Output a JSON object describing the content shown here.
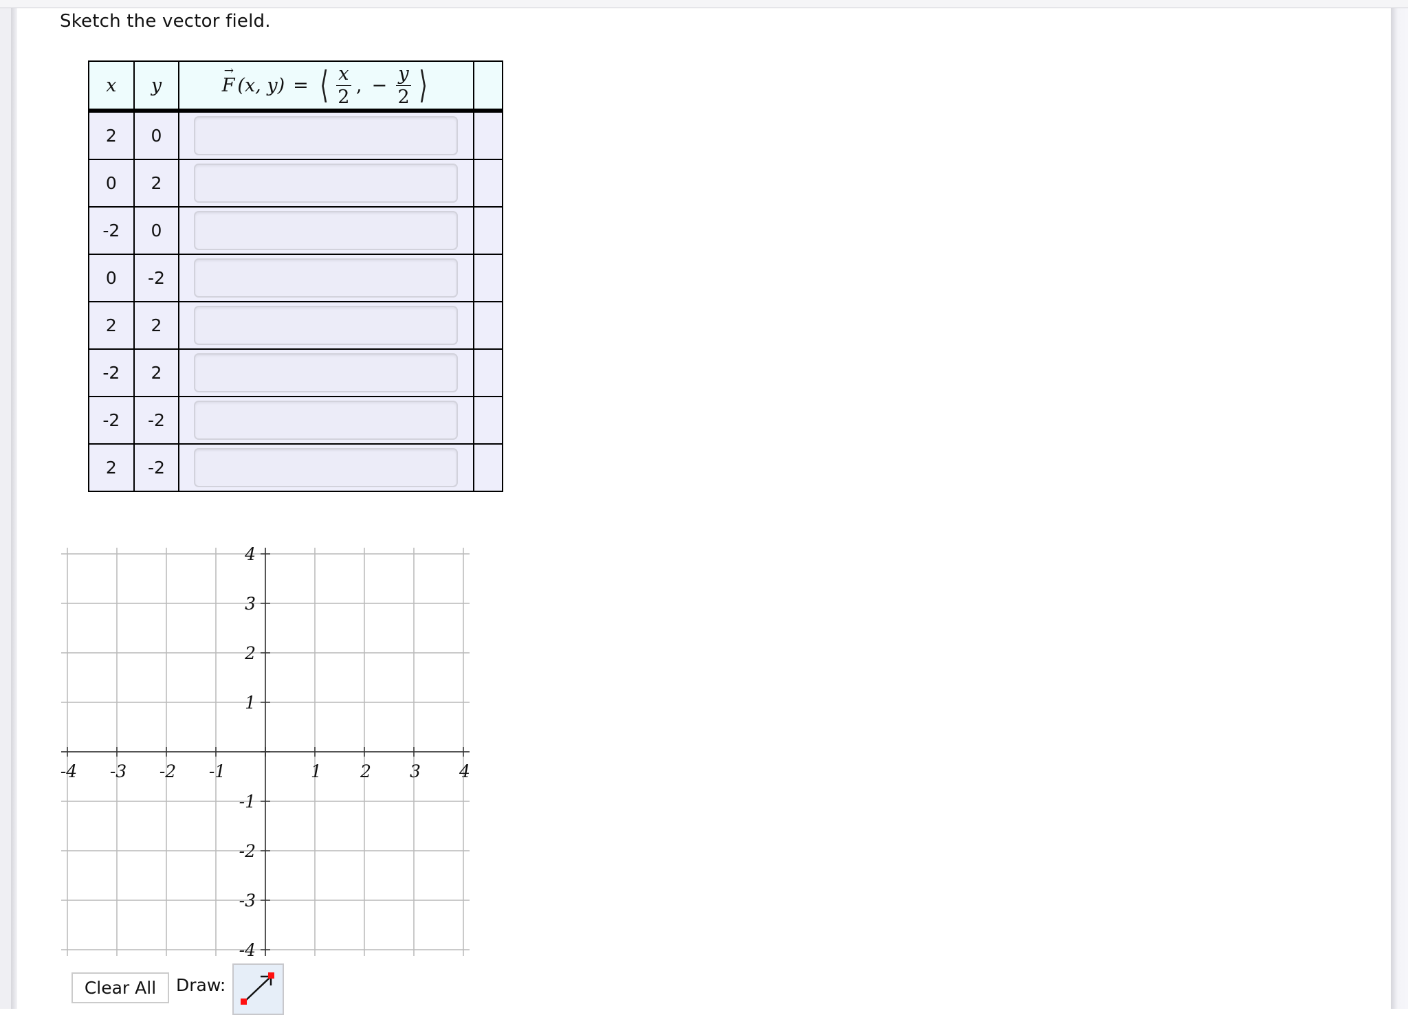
{
  "prompt": "Sketch the vector field.",
  "table": {
    "headers": {
      "x": "x",
      "y": "y",
      "formula": {
        "lhs_symbol": "F",
        "lhs_args": "(x, y)",
        "equals": "=",
        "open": "⟨",
        "close": "⟩",
        "comp1_num": "x",
        "comp1_den": "2",
        "sep": ",",
        "minus": "−",
        "comp2_num": "y",
        "comp2_den": "2"
      },
      "extra": ""
    },
    "rows": [
      {
        "x": "2",
        "y": "0",
        "answer": "",
        "placeholder": ""
      },
      {
        "x": "0",
        "y": "2",
        "answer": "",
        "placeholder": ""
      },
      {
        "x": "-2",
        "y": "0",
        "answer": "",
        "placeholder": ""
      },
      {
        "x": "0",
        "y": "-2",
        "answer": "",
        "placeholder": ""
      },
      {
        "x": "2",
        "y": "2",
        "answer": "",
        "placeholder": ""
      },
      {
        "x": "-2",
        "y": "2",
        "answer": "",
        "placeholder": ""
      },
      {
        "x": "-2",
        "y": "-2",
        "answer": "",
        "placeholder": ""
      },
      {
        "x": "2",
        "y": "-2",
        "answer": "",
        "placeholder": ""
      }
    ]
  },
  "graph": {
    "xmin": -4,
    "xmax": 4,
    "ymin": -4,
    "ymax": 4,
    "x_ticks": [
      "-4",
      "-3",
      "-2",
      "-1",
      "1",
      "2",
      "3",
      "4"
    ],
    "y_ticks": [
      "4",
      "3",
      "2",
      "1",
      "-1",
      "-2",
      "-3",
      "-4"
    ],
    "grid": true,
    "vectors": []
  },
  "controls": {
    "clear_all_label": "Clear All",
    "draw_label": "Draw:",
    "draw_tool": "vector-arrow-icon",
    "draw_tool_accent": "#ff0000"
  },
  "colors": {
    "header_bg": "#eefcfd",
    "cell_bg": "#eeeefb",
    "grid_line": "#b9b9b9",
    "axis_line": "#555555",
    "tool_bg": "#e6eef8"
  }
}
